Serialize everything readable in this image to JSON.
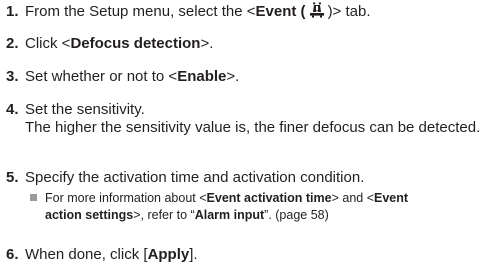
{
  "steps": [
    {
      "num": "1.",
      "pre": "From the Setup menu, select the <",
      "bold": "Event (",
      "post": ")> tab.",
      "icon": "event-icon"
    },
    {
      "num": "2.",
      "pre": "Click <",
      "bold": "Defocus detection",
      "post": ">."
    },
    {
      "num": "3.",
      "pre": "Set whether or not to <",
      "bold": "Enable",
      "post": ">."
    },
    {
      "num": "4.",
      "text": "Set the sensitivity.",
      "line2": "The higher the sensitivity value is, the finer defocus can be detected."
    },
    {
      "num": "5.",
      "text": "Specify the activation time and activation condition."
    },
    {
      "num": "6.",
      "pre": "When done, click [",
      "bold": "Apply",
      "post": "]."
    }
  ],
  "note": {
    "p1": "For more information about <",
    "b1": "Event activation time",
    "p2": "> and <",
    "b2": "Event",
    "b3": "action settings",
    "p3": ">, refer to “",
    "b4": "Alarm input",
    "p4": "”. (page 58)"
  }
}
